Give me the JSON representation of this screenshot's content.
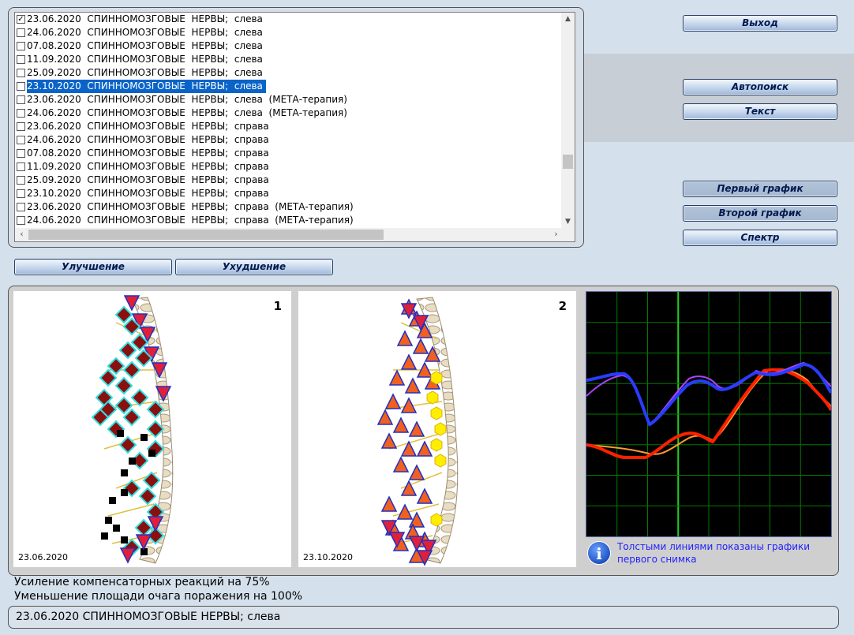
{
  "list": {
    "rows": [
      {
        "checked": true,
        "text": "23.06.2020  СПИННОМОЗГОВЫЕ  НЕРВЫ;  слева"
      },
      {
        "checked": false,
        "text": "24.06.2020  СПИННОМОЗГОВЫЕ  НЕРВЫ;  слева"
      },
      {
        "checked": false,
        "text": "07.08.2020  СПИННОМОЗГОВЫЕ  НЕРВЫ;  слева"
      },
      {
        "checked": false,
        "text": "11.09.2020  СПИННОМОЗГОВЫЕ  НЕРВЫ;  слева"
      },
      {
        "checked": false,
        "text": "25.09.2020  СПИННОМОЗГОВЫЕ  НЕРВЫ;  слева"
      },
      {
        "checked": false,
        "text": "23.10.2020  СПИННОМОЗГОВЫЕ  НЕРВЫ;  слева",
        "selected": true
      },
      {
        "checked": false,
        "text": "23.06.2020  СПИННОМОЗГОВЫЕ  НЕРВЫ;  слева  (МЕТА-терапия)"
      },
      {
        "checked": false,
        "text": "24.06.2020  СПИННОМОЗГОВЫЕ  НЕРВЫ;  слева  (МЕТА-терапия)"
      },
      {
        "checked": false,
        "text": "23.06.2020  СПИННОМОЗГОВЫЕ  НЕРВЫ;  справа"
      },
      {
        "checked": false,
        "text": "24.06.2020  СПИННОМОЗГОВЫЕ  НЕРВЫ;  справа"
      },
      {
        "checked": false,
        "text": "07.08.2020  СПИННОМОЗГОВЫЕ  НЕРВЫ;  справа"
      },
      {
        "checked": false,
        "text": "11.09.2020  СПИННОМОЗГОВЫЕ  НЕРВЫ;  справа"
      },
      {
        "checked": false,
        "text": "25.09.2020  СПИННОМОЗГОВЫЕ  НЕРВЫ;  справа"
      },
      {
        "checked": false,
        "text": "23.10.2020  СПИННОМОЗГОВЫЕ  НЕРВЫ;  справа"
      },
      {
        "checked": false,
        "text": "23.06.2020  СПИННОМОЗГОВЫЕ  НЕРВЫ;  справа  (МЕТА-терапия)"
      },
      {
        "checked": false,
        "text": "24.06.2020  СПИННОМОЗГОВЫЕ  НЕРВЫ;  справа  (МЕТА-терапия)"
      }
    ]
  },
  "buttons": {
    "exit": "Выход",
    "autosearch": "Автопоиск",
    "text": "Текст",
    "first_graph": "Первый график",
    "second_graph": "Второй график",
    "spectrum": "Спектр",
    "improvement": "Улучшение",
    "deterioration": "Ухудшение"
  },
  "panels": {
    "first": {
      "number": "1",
      "date": "23.06.2020"
    },
    "second": {
      "number": "2",
      "date": "23.10.2020"
    }
  },
  "graph_note": "Толстыми линиями показаны графики первого снимка",
  "status": {
    "line1": "Усиление компенсаторных реакций на 75%",
    "line2": "Уменьшение площади очага поражения на 100%"
  },
  "current_record": "23.06.2020 СПИННОМОЗГОВЫЕ  НЕРВЫ;  слева",
  "colors": {
    "selection": "#0a64c8",
    "graph_bg": "#000000",
    "grid": "#00a000",
    "blue_series": "#2a3cff",
    "violet_series": "#b040ff",
    "red_series": "#ff2000",
    "orange_series": "#ff9a30",
    "note_text": "#2222ff"
  },
  "icons": {
    "info": "info-icon",
    "checkbox": "checkbox-icon",
    "scroll_up": "scroll-up-icon",
    "scroll_down": "scroll-down-icon",
    "scroll_left": "scroll-left-icon",
    "scroll_right": "scroll-right-icon",
    "marker_triangle": "triangle-marker-icon",
    "marker_diamond": "diamond-marker-icon",
    "marker_square": "square-marker-icon",
    "marker_hexagon": "hexagon-marker-icon"
  }
}
